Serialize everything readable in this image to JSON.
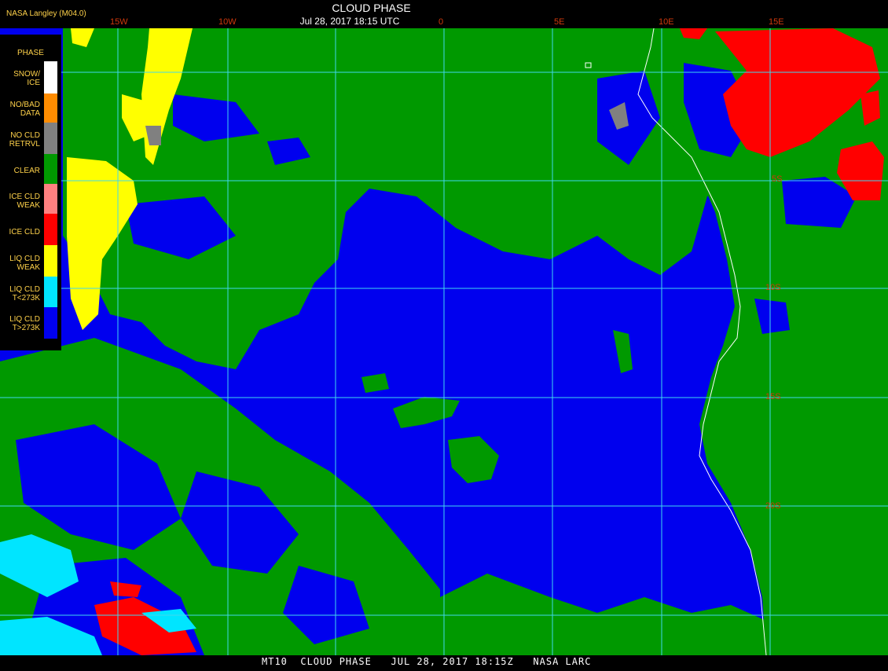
{
  "header": {
    "producer": "NASA Langley (M04.0)",
    "title": "CLOUD PHASE",
    "datetime": "Jul 28, 2017 18:15 UTC"
  },
  "footer": {
    "text": "MT10  CLOUD PHASE   JUL 28, 2017 18:15Z   NASA LARC"
  },
  "legend": {
    "title": "PHASE",
    "items": [
      {
        "label": "SNOW/\nICE",
        "color": "#ffffff"
      },
      {
        "label": "NO/BAD\nDATA",
        "color": "#ff8c00"
      },
      {
        "label": "NO CLD\nRETRVL",
        "color": "#808080"
      },
      {
        "label": "CLEAR",
        "color": "#009900"
      },
      {
        "label": "ICE CLD\nWEAK",
        "color": "#ff8080"
      },
      {
        "label": "ICE CLD",
        "color": "#ff0000"
      },
      {
        "label": "LIQ CLD\nWEAK",
        "color": "#ffff00"
      },
      {
        "label": "LIQ CLD\nT<273K",
        "color": "#00e5ff"
      },
      {
        "label": "LIQ CLD\nT>273K",
        "color": "#0000ee"
      }
    ]
  },
  "grid": {
    "longitude_labels": [
      "15W",
      "10W",
      "0",
      "5E",
      "10E",
      "15E"
    ],
    "latitude_labels": [
      "5S",
      "10S",
      "15S",
      "20S"
    ]
  },
  "colors": {
    "grid_lines": "#40d8ee",
    "coastline": "#ffffff",
    "tick_labels": "#d0380c",
    "header_text": "#ffd24a"
  }
}
